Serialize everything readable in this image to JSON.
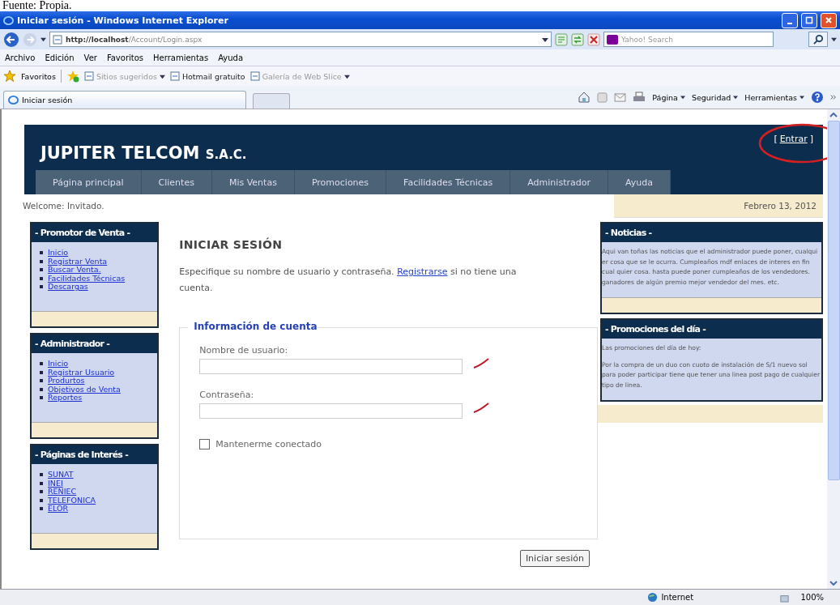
{
  "caption": "Fuente: Propia.",
  "window": {
    "title": "Iniciar sesión - Windows Internet Explorer"
  },
  "address_bar": {
    "url_host": "http://localhost",
    "url_path": "/Account/Login.aspx",
    "search_placeholder": "Yahoo! Search"
  },
  "menu": [
    "Archivo",
    "Edición",
    "Ver",
    "Favoritos",
    "Herramientas",
    "Ayuda"
  ],
  "favorites_bar": {
    "label": "Favoritos",
    "links": [
      {
        "label": "Sitios sugeridos",
        "dropdown": true,
        "disabled": true
      },
      {
        "label": "Hotmail gratuito",
        "dropdown": false,
        "disabled": false
      },
      {
        "label": "Galería de Web Slice",
        "dropdown": true,
        "disabled": true
      }
    ]
  },
  "tab": {
    "title": "Iniciar sesión"
  },
  "command_bar": [
    "Página",
    "Seguridad",
    "Herramientas"
  ],
  "site": {
    "brand": "JUPITER TELCOM",
    "brand_suffix": "S.A.C.",
    "login": {
      "open": "[",
      "label": "Entrar",
      "close": "]"
    },
    "nav": [
      "Página principal",
      "Clientes",
      "Mis Ventas",
      "Promociones",
      "Facilidades Técnicas",
      "Administrador",
      "Ayuda"
    ],
    "welcome": "Welcome: Invitado.",
    "date": "Febrero 13, 2012"
  },
  "sidebar": [
    {
      "title": "- Promotor de Venta -",
      "links": [
        "Inicio",
        "Registrar Venta",
        "Buscar Venta.",
        "Facilidades Técnicas",
        "Descargas"
      ]
    },
    {
      "title": "- Administrador -",
      "links": [
        "Inicio",
        "Registrar Usuario",
        "Produrtos",
        "Objetivos de Venta",
        "Reportes"
      ]
    },
    {
      "title": "- Páginas de Interés -",
      "links": [
        "SUNAT",
        "INEI",
        "RENIEC",
        "TELEFONICA",
        "ELOR"
      ]
    }
  ],
  "login_form": {
    "heading": "INICIAR SESIÓN",
    "intro_before": "Especifique su nombre de usuario y contraseña.",
    "intro_link": "Registrarse",
    "intro_after": "si no tiene una cuenta.",
    "legend": "Información de cuenta",
    "fields": [
      {
        "label": "Nombre de usuario:",
        "marked": true
      },
      {
        "label": "Contraseña:",
        "marked": true
      }
    ],
    "remember": {
      "label": "Mantenerme conectado",
      "checked": false
    },
    "button": "Iniciar sesión"
  },
  "right_panels": [
    {
      "title": "- Noticias -",
      "paragraphs": [
        "Aqui van toñas las noticias que el administrador puede poner, cualqui er cosa que se le ocurra. Cumpleaños mdf enlaces de interes en fin cual quier cosa. hasta puede poner cumpleaños de los vendedores. ganadores de algún premio mejor vendedor del mes. etc."
      ]
    },
    {
      "title": "- Promociones del día -",
      "paragraphs": [
        "Las promociones del día de hoy:",
        "Por la compra de un duo con cuoto de instalación de S/1 nuevo sol para poder participar tiene que tener una linea post pago de cualquier tipo de linea."
      ]
    }
  ],
  "status_bar": {
    "zone": "Internet",
    "zoom": "100%"
  }
}
